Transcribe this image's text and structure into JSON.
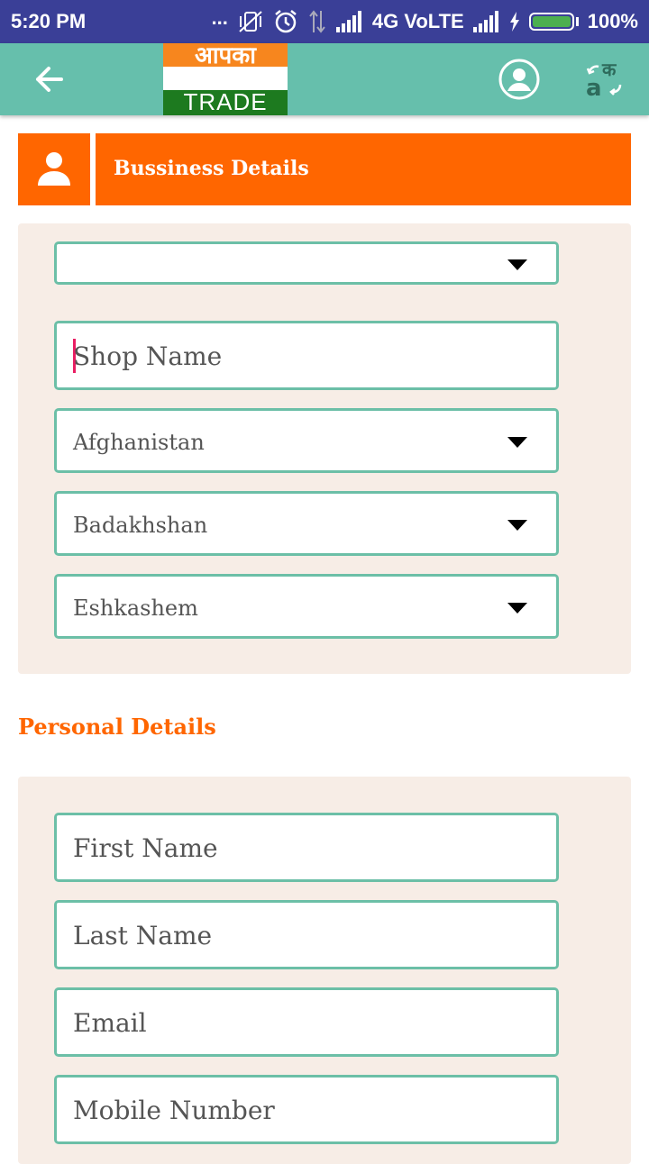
{
  "status_bar": {
    "time": "5:20 PM",
    "dots": "...",
    "network": "4G VoLTE",
    "battery": "100%"
  },
  "toolbar": {
    "logo_line1": "आपका",
    "logo_line2": "TRADE",
    "icons": {
      "back": "arrow-left-icon",
      "profile": "account-circle-icon",
      "language": "translate-icon"
    }
  },
  "business": {
    "header": "Bussiness Details",
    "category_value": "",
    "shop_name_placeholder": "Shop Name",
    "country": "Afghanistan",
    "state": "Badakhshan",
    "city": "Eshkashem"
  },
  "personal": {
    "header": "Personal Details",
    "first_name_placeholder": "First Name",
    "last_name_placeholder": "Last Name",
    "email_placeholder": "Email",
    "mobile_placeholder": "Mobile Number"
  },
  "colors": {
    "status_bar": "#3a3f97",
    "toolbar": "#66bfac",
    "accent": "#ff6600",
    "field_border": "#6cbfa7",
    "panel_bg": "#f7ede6"
  }
}
